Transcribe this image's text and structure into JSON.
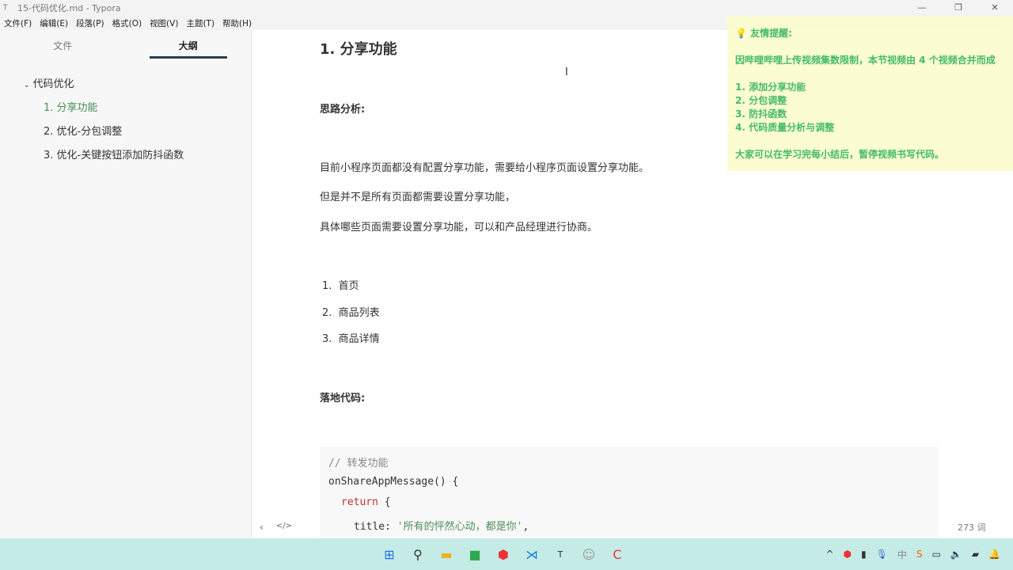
{
  "window": {
    "title": "15-代码优化.md - Typora",
    "app_icon": "T"
  },
  "menu": [
    "文件(F)",
    "编辑(E)",
    "段落(P)",
    "格式(O)",
    "视图(V)",
    "主题(T)",
    "帮助(H)"
  ],
  "sidebar": {
    "tabs": [
      "文件",
      "大纲"
    ],
    "outline": {
      "root": "代码优化",
      "items": [
        "1. 分享功能",
        "2. 优化-分包调整",
        "3. 优化-关键按钮添加防抖函数"
      ]
    }
  },
  "doc": {
    "heading": "1. 分享功能",
    "analysis_title": "思路分析:",
    "paragraphs": [
      "目前小程序页面都没有配置分享功能，需要给小程序页面设置分享功能。",
      "但是并不是所有页面都需要设置分享功能，",
      "具体哪些页面需要设置分享功能，可以和产品经理进行协商。"
    ],
    "list": [
      "首页",
      "商品列表",
      "商品详情"
    ],
    "code_title": "落地代码:",
    "code": {
      "comment": "// 转发功能",
      "line2": "onShareAppMessage() {",
      "kw": "return",
      "brace": " {",
      "key": "title: ",
      "str": "'所有的怦然心动，都是你'",
      "comma": ","
    }
  },
  "tip": {
    "title": "友情提醒:",
    "line1": "因哔哩哔哩上传视频集数限制，本节视频由 4 个视频合并而成",
    "items": [
      "1. 添加分享功能",
      "2. 分包调整",
      "3. 防抖函数",
      "4. 代码质量分析与调整"
    ],
    "footer": "大家可以在学习完每小结后，暂停视频书写代码。"
  },
  "status": {
    "word_count": "273 词"
  }
}
